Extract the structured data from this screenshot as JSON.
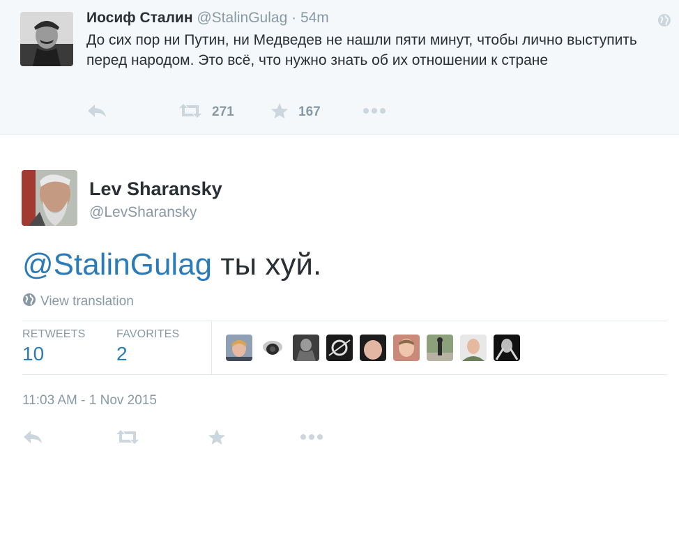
{
  "parent_tweet": {
    "name": "Иосиф Сталин",
    "handle": "@StalinGulag",
    "dot": "·",
    "time": "54m",
    "text": "До сих пор ни Путин, ни Медведев не нашли пяти минут, чтобы лично выступить перед народом. Это всё, что нужно знать об их отношении к стране",
    "retweet_count": "271",
    "favorite_count": "167"
  },
  "main_tweet": {
    "name": "Lev Sharansky",
    "handle": "@LevSharansky",
    "mention": "@StalinGulag",
    "text_rest": " ты хуй.",
    "translate_label": "View translation",
    "stats": {
      "retweets_label": "RETWEETS",
      "retweets_value": "10",
      "favorites_label": "FAVORITES",
      "favorites_value": "2"
    },
    "favoriter_avatars": [
      "avatar-blond-man",
      "avatar-security-camera",
      "avatar-soldier",
      "avatar-black-white-pattern",
      "avatar-bald-head",
      "avatar-man-red-bg",
      "avatar-person-outdoors",
      "avatar-young-man",
      "avatar-putin-collage"
    ],
    "timestamp": "11:03 AM - 1 Nov 2015"
  },
  "icons": {
    "reply": "reply-icon",
    "retweet": "retweet-icon",
    "favorite": "star-icon",
    "more": "more-icon",
    "globe": "globe-icon"
  },
  "colors": {
    "link": "#2b7bb9",
    "muted": "#8899a6",
    "text": "#292f33",
    "parent_bg": "#f5f8fa",
    "border": "#e1e8ed"
  }
}
